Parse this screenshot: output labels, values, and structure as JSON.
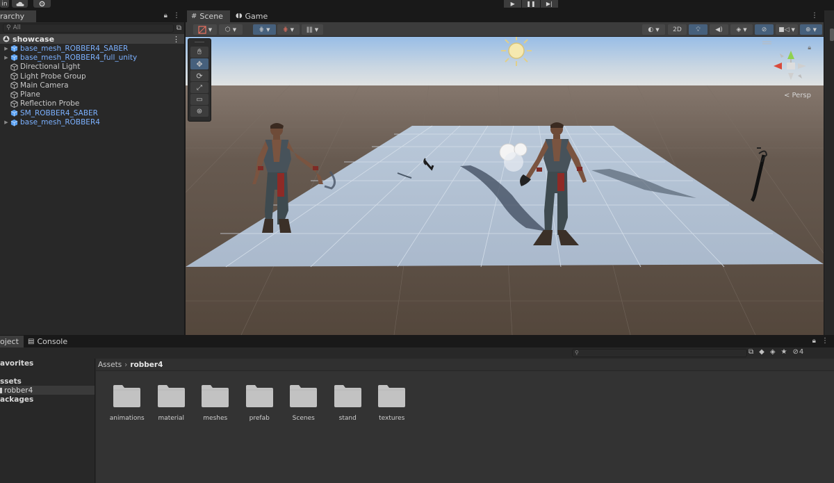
{
  "toolbar": {
    "left_btn1": "in",
    "cloud_icon": "cloud-icon",
    "settings_icon": "gear-icon",
    "play_icons": [
      "play-icon",
      "pause-icon",
      "step-icon"
    ]
  },
  "hierarchy": {
    "tab_label": "rarchy",
    "search_placeholder": "All",
    "scene_name": "showcase",
    "items": [
      {
        "label": "base_mesh_ROBBER4_SABER",
        "prefab": true,
        "expandable": true
      },
      {
        "label": "base_mesh_ROBBER4_full_unity",
        "prefab": true,
        "expandable": true
      },
      {
        "label": "Directional Light",
        "prefab": false,
        "expandable": false
      },
      {
        "label": "Light Probe Group",
        "prefab": false,
        "expandable": false
      },
      {
        "label": "Main Camera",
        "prefab": false,
        "expandable": false
      },
      {
        "label": "Plane",
        "prefab": false,
        "expandable": false
      },
      {
        "label": "Reflection Probe",
        "prefab": false,
        "expandable": false
      },
      {
        "label": "SM_ROBBER4_SABER",
        "prefab": true,
        "expandable": false
      },
      {
        "label": "base_mesh_ROBBER4",
        "prefab": true,
        "expandable": true
      }
    ]
  },
  "scene": {
    "tabs": [
      {
        "label": "Scene",
        "icon": "grid-icon"
      },
      {
        "label": "Game",
        "icon": "gamepad-icon"
      }
    ],
    "toggle_2d": "2D",
    "persp_label": "< Persp"
  },
  "project": {
    "tabs": [
      {
        "label": "oject",
        "icon": "folder-icon"
      },
      {
        "label": "Console",
        "icon": "console-icon"
      }
    ],
    "hidden_count": "4",
    "left_items": [
      {
        "label": "avorites",
        "bold": true,
        "selected": false
      },
      {
        "label": "",
        "bold": false,
        "selected": false
      },
      {
        "label": "ssets",
        "bold": true,
        "selected": false
      },
      {
        "label": "robber4",
        "bold": false,
        "selected": true
      },
      {
        "label": "ackages",
        "bold": true,
        "selected": false
      }
    ],
    "breadcrumb": {
      "root": "Assets",
      "current": "robber4"
    },
    "folders": [
      "animations",
      "material",
      "meshes",
      "prefab",
      "Scenes",
      "stand",
      "textures"
    ]
  },
  "colors": {
    "prefab_blue": "#7cb1ff",
    "plane_color": "#b8c8de",
    "ground_color": "#5c5048",
    "sky_top": "#9ec0e4"
  }
}
